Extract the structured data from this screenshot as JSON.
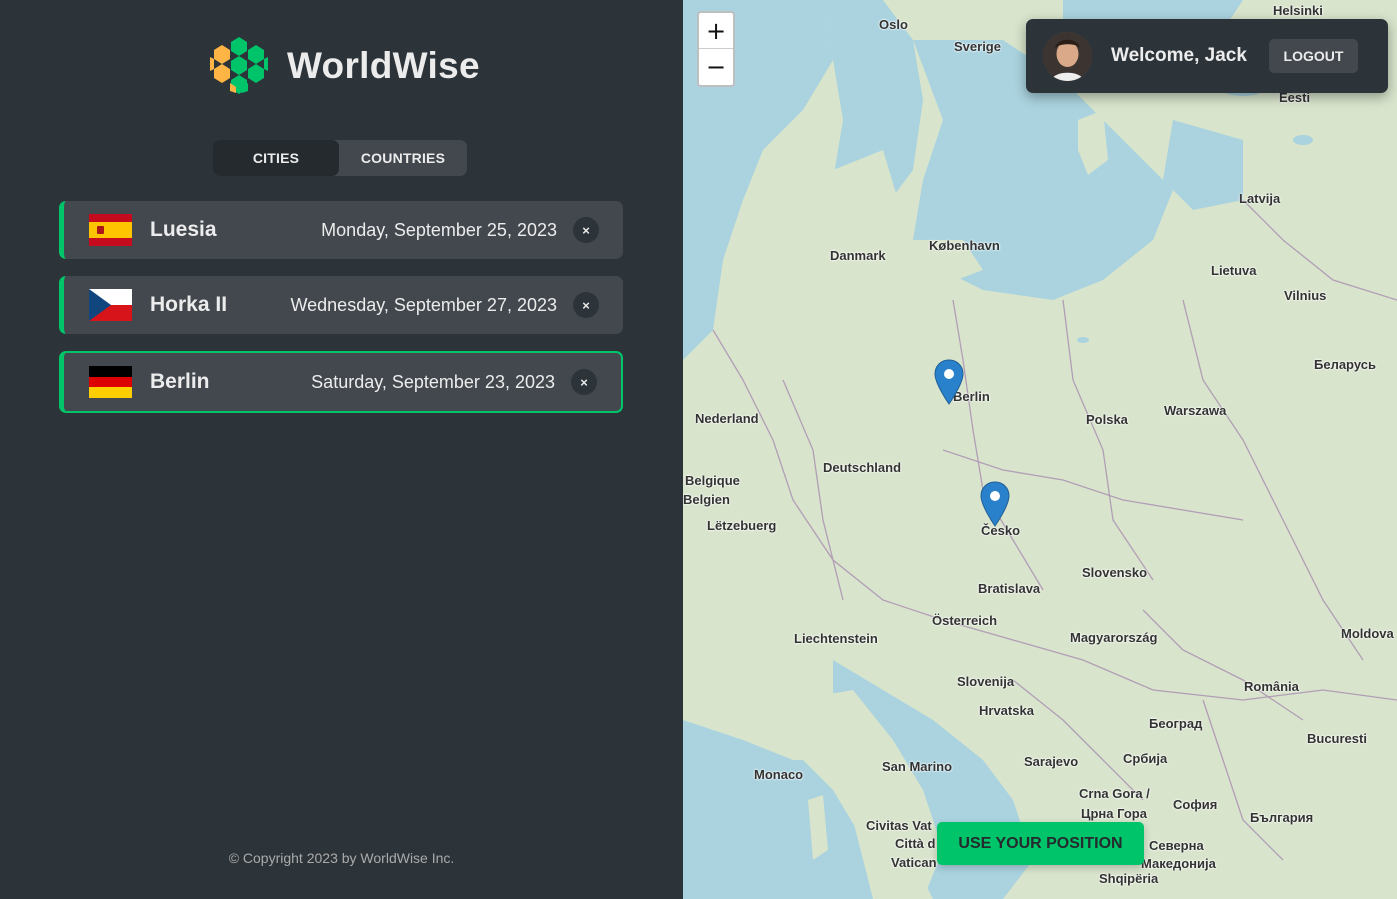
{
  "app": {
    "name": "WorldWise"
  },
  "tabs": [
    {
      "label": "CITIES"
    },
    {
      "label": "COUNTRIES"
    }
  ],
  "cities": [
    {
      "name": "Luesia",
      "date": "Monday, September 25, 2023",
      "flag": "spain-flag",
      "delete": "×"
    },
    {
      "name": "Horka II",
      "date": "Wednesday, September 27, 2023",
      "flag": "czech-flag",
      "delete": "×"
    },
    {
      "name": "Berlin",
      "date": "Saturday, September 23, 2023",
      "flag": "germany-flag",
      "delete": "×"
    }
  ],
  "footer": {
    "copyright": "© Copyright 2023 by WorldWise Inc."
  },
  "map": {
    "zoom_in": "+",
    "zoom_out": "−",
    "welcome": "Welcome, Jack",
    "logout": "LOGOUT",
    "position_button": "USE YOUR POSITION",
    "labels": [
      "Oslo",
      "Sverige",
      "Helsinki",
      "Eesti",
      "Latvija",
      "Lietuva",
      "Vilnius",
      "København",
      "Danmark",
      "Berlin",
      "Nederland",
      "Polska",
      "Warszawa",
      "Беларусь",
      "Deutschland",
      "Belgique",
      "Belgien",
      "Lëtzebuerg",
      "Česko",
      "Slovensko",
      "Bratislava",
      "Österreich",
      "Liechtenstein",
      "Magyarország",
      "Moldova",
      "Slovenija",
      "România",
      "Hrvatska",
      "Београд",
      "Bucuresti",
      "Monaco",
      "San Marino",
      "Sarajevo",
      "Србија",
      "Crna Gora /",
      "Црна Гора",
      "София",
      "България",
      "Civitas Vat",
      "Città d",
      "Vatican",
      "Северна",
      "Македонија",
      "Shqipëria"
    ]
  },
  "colors": {
    "accent": "#00c46a",
    "dark": "#2d3439",
    "panel": "#42484d",
    "text": "#ececec",
    "marker": "#2a81cb"
  }
}
